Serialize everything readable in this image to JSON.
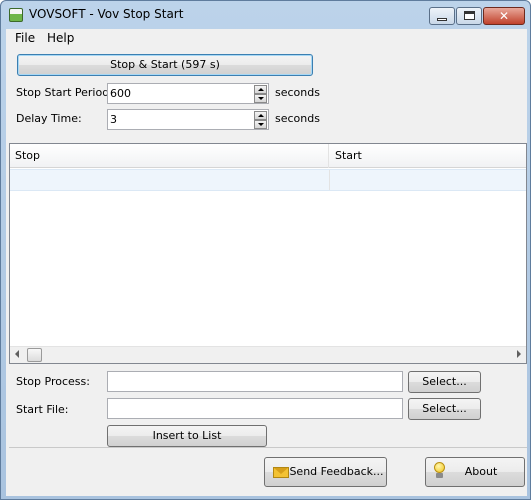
{
  "window": {
    "title": "VOVSOFT - Vov Stop Start"
  },
  "menu": {
    "items": [
      "File",
      "Help"
    ]
  },
  "main": {
    "stop_start_button": "Stop & Start (597 s)",
    "period_label": "Stop Start Period:",
    "period_value": "600",
    "period_unit": "seconds",
    "delay_label": "Delay Time:",
    "delay_value": "3",
    "delay_unit": "seconds"
  },
  "list": {
    "columns": [
      "Stop",
      "Start"
    ]
  },
  "form": {
    "stop_process_label": "Stop Process:",
    "stop_process_value": "",
    "start_file_label": "Start File:",
    "start_file_value": "",
    "select_label": "Select...",
    "insert_label": "Insert to List"
  },
  "footer": {
    "feedback_label": "Send Feedback...",
    "about_label": "About"
  },
  "colors": {
    "accent": "#3c7fb1",
    "row_highlight": "#eef5fc"
  }
}
